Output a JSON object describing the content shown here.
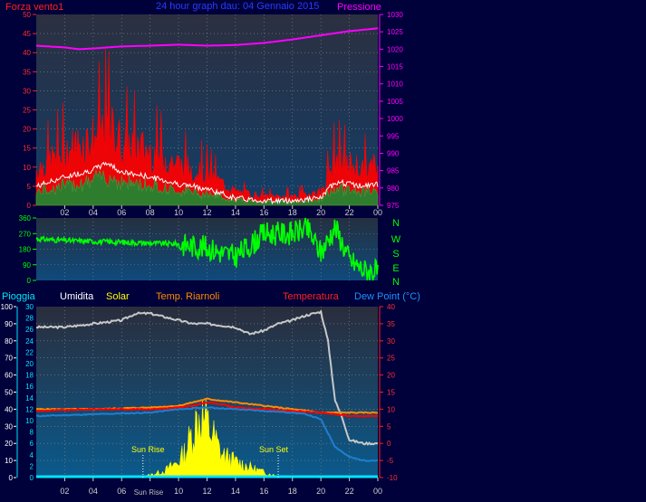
{
  "header": {
    "left_title": "Forza vento1",
    "center_title": "24 hour graph dau: 04 Gennaio 2015",
    "right_title": "Pressione"
  },
  "bottom_header": {
    "pioggia": "Pioggia",
    "umidita": "Umidita",
    "solar": "Solar",
    "temp_riarnoli": "Temp. Riarnoli",
    "temperatura": "Temperatura",
    "dew_point": "Dew Point (°C)"
  },
  "direction_labels": [
    "N",
    "W",
    "S",
    "E",
    "N"
  ],
  "annotations": {
    "sun_rise": "Sun Rise",
    "sun_set": "Sun Set"
  },
  "colors": {
    "background": "#00003a",
    "plot_bg_top": "#262b3e",
    "plot_bg_bottom": "#0a5080",
    "wind_gust": "#ff0000",
    "wind_avg": "#ffffff",
    "wind_speed": "#2e7d2e",
    "pressure": "#ff00ff",
    "direction": "#00ff00",
    "humidity": "#c8c8c8",
    "solar": "#ffff00",
    "temp_indoor": "#ff8c00",
    "temperature": "#ff0000",
    "dew_point": "#1e7fd0",
    "rain": "#00e5ff"
  },
  "chart_data": [
    {
      "type": "area",
      "x_ticks": [
        "02",
        "04",
        "06",
        "08",
        "10",
        "12",
        "14",
        "16",
        "18",
        "20",
        "22",
        "00"
      ],
      "y_left": {
        "range": [
          0,
          50
        ],
        "ticks": [
          0,
          5,
          10,
          15,
          20,
          25,
          30,
          35,
          40,
          45,
          50
        ]
      },
      "y_right": {
        "range": [
          975,
          1030
        ],
        "ticks": [
          975,
          980,
          985,
          990,
          995,
          1000,
          1005,
          1010,
          1015,
          1020,
          1025,
          1030
        ]
      },
      "series": [
        {
          "name": "Forza vento1",
          "axis": "left",
          "x": [
            0,
            2,
            4,
            5,
            6,
            8,
            10,
            12,
            14,
            16,
            18,
            20,
            21,
            22,
            23,
            24
          ],
          "values": [
            8,
            12,
            15,
            18,
            14,
            12,
            9,
            7,
            3,
            2,
            2,
            3,
            10,
            9,
            8,
            9
          ]
        },
        {
          "name": "Pressione",
          "axis": "right",
          "x": [
            0,
            2,
            3,
            4,
            5,
            6,
            8,
            10,
            12,
            14,
            16,
            18,
            20,
            22,
            24
          ],
          "values": [
            1021,
            1020.5,
            1020,
            1020.2,
            1020.5,
            1020.8,
            1021,
            1021.3,
            1021,
            1021.2,
            1021.8,
            1022.8,
            1024,
            1025.2,
            1026
          ]
        }
      ]
    },
    {
      "type": "scatter",
      "x_ticks": [
        "02",
        "04",
        "06",
        "08",
        "10",
        "12",
        "14",
        "16",
        "18",
        "20",
        "22",
        "00"
      ],
      "y_range": [
        0,
        360
      ],
      "y_ticks": [
        0,
        90,
        180,
        270,
        360
      ],
      "series": [
        {
          "name": "direction",
          "x": [
            0,
            2,
            4,
            6,
            8,
            10,
            11,
            12,
            13,
            14,
            15,
            16,
            17,
            18,
            19,
            20,
            21,
            22,
            23,
            24
          ],
          "values": [
            240,
            230,
            225,
            220,
            215,
            210,
            200,
            190,
            160,
            140,
            200,
            270,
            270,
            270,
            300,
            160,
            310,
            120,
            60,
            50
          ]
        }
      ]
    },
    {
      "type": "line",
      "x_ticks": [
        "02",
        "04",
        "06",
        "08",
        "10",
        "12",
        "14",
        "16",
        "18",
        "20",
        "22",
        "00"
      ],
      "x_annotation_ticks": {
        "Sun Rise": 7.5,
        "Sun Set": 17.0
      },
      "y_left_outer": {
        "label": "Pioggia",
        "range": [
          0,
          100
        ],
        "ticks": [
          0,
          10,
          20,
          30,
          40,
          50,
          60,
          70,
          80,
          90,
          100
        ]
      },
      "y_left_inner": {
        "label": "Umidita",
        "range": [
          0,
          30
        ],
        "ticks": [
          0,
          2,
          4,
          6,
          8,
          10,
          12,
          14,
          16,
          18,
          20,
          22,
          24,
          26,
          28,
          30
        ]
      },
      "y_right": {
        "label": "Temperatura",
        "range": [
          -10,
          40
        ],
        "ticks": [
          -10,
          -5,
          0,
          5,
          10,
          15,
          20,
          25,
          30,
          35,
          40
        ]
      },
      "series": [
        {
          "name": "Umidita",
          "axis": "left_outer",
          "x": [
            0,
            2,
            4,
            6,
            7,
            8,
            9,
            10,
            11,
            12,
            13,
            14,
            15,
            16,
            17,
            18,
            19,
            20,
            20.5,
            21,
            21.5,
            22,
            23,
            24
          ],
          "values": [
            88,
            88,
            90,
            92,
            96,
            96,
            94,
            92,
            90,
            90,
            89,
            88,
            84,
            86,
            90,
            92,
            95,
            97,
            80,
            45,
            35,
            22,
            20,
            20
          ]
        },
        {
          "name": "Solar",
          "axis": "left_outer",
          "x": [
            0,
            7,
            8,
            9,
            10,
            10.5,
            11,
            11.5,
            12,
            12.5,
            13,
            14,
            15,
            16,
            17,
            18,
            24
          ],
          "values": [
            0,
            0,
            2,
            5,
            12,
            20,
            35,
            48,
            40,
            30,
            18,
            12,
            8,
            4,
            1,
            0,
            0
          ]
        },
        {
          "name": "Temp. Riarnoli",
          "axis": "right",
          "x": [
            0,
            4,
            8,
            10,
            11,
            12,
            13,
            14,
            16,
            18,
            20,
            21,
            22,
            24
          ],
          "values": [
            10,
            10,
            10.5,
            11,
            12,
            13,
            12.5,
            12,
            11,
            10,
            9,
            9,
            9,
            9
          ]
        },
        {
          "name": "Temperatura",
          "axis": "right",
          "x": [
            0,
            4,
            8,
            10,
            11,
            12,
            13,
            14,
            16,
            18,
            20,
            21,
            22,
            24
          ],
          "values": [
            9.5,
            10,
            10,
            10.5,
            11,
            12,
            11.5,
            10.5,
            10,
            9.5,
            9,
            8.5,
            8,
            8
          ]
        },
        {
          "name": "Dew Point (°C)",
          "axis": "right",
          "x": [
            0,
            4,
            8,
            10,
            12,
            14,
            16,
            18,
            19,
            20,
            20.5,
            21,
            22,
            23,
            24
          ],
          "values": [
            8,
            8.5,
            9,
            10,
            10.5,
            10,
            9.5,
            9,
            8.5,
            7,
            3,
            -1,
            -4,
            -5,
            -5
          ]
        },
        {
          "name": "Pioggia",
          "axis": "left_outer",
          "x": [
            0,
            24
          ],
          "values": [
            0,
            0
          ]
        }
      ]
    }
  ]
}
